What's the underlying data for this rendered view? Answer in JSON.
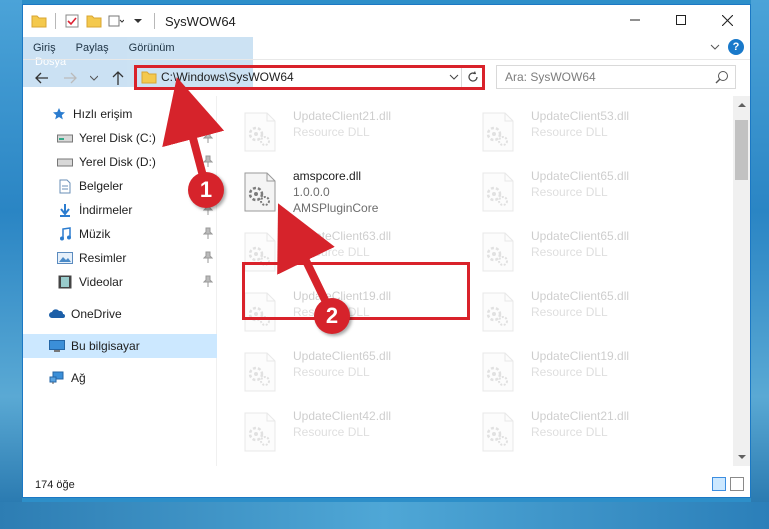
{
  "window": {
    "title": "SysWOW64",
    "controls": {
      "minimize": "—",
      "maximize": "☐",
      "close": "✕"
    }
  },
  "ribbon": {
    "tabs": [
      "Dosya",
      "Giriş",
      "Paylaş",
      "Görünüm"
    ],
    "help": "?"
  },
  "address": {
    "path": "C:\\Windows\\SysWOW64",
    "search_placeholder": "Ara: SysWOW64"
  },
  "sidebar": {
    "items": [
      {
        "label": "Hızlı erişim",
        "icon": "star-icon"
      },
      {
        "label": "Yerel Disk (C:)",
        "icon": "drive-icon",
        "pinned": true
      },
      {
        "label": "Yerel Disk (D:)",
        "icon": "drive-icon",
        "pinned": true
      },
      {
        "label": "Belgeler",
        "icon": "documents-icon",
        "pinned": true
      },
      {
        "label": "İndirmeler",
        "icon": "download-icon",
        "pinned": true
      },
      {
        "label": "Müzik",
        "icon": "music-icon",
        "pinned": true
      },
      {
        "label": "Resimler",
        "icon": "pictures-icon",
        "pinned": true
      },
      {
        "label": "Videolar",
        "icon": "videos-icon",
        "pinned": true
      },
      {
        "label": "OneDrive",
        "icon": "onedrive-icon"
      },
      {
        "label": "Bu bilgisayar",
        "icon": "computer-icon",
        "selected": true
      },
      {
        "label": "Ağ",
        "icon": "network-icon"
      }
    ]
  },
  "files": [
    {
      "name": "UpdateClient21.dll",
      "desc": "Resource DLL"
    },
    {
      "name": "UpdateClient53.dll",
      "desc": "Resource DLL"
    },
    {
      "name": "amspcore.dll",
      "version": "1.0.0.0",
      "desc": "AMSPluginCore"
    },
    {
      "name": "UpdateClient65.dll",
      "desc": "Resource DLL"
    },
    {
      "name": "UpdateClient63.dll",
      "desc": "Resource DLL"
    },
    {
      "name": "UpdateClient65.dll",
      "desc": "Resource DLL"
    },
    {
      "name": "UpdateClient19.dll",
      "desc": "Resource DLL"
    },
    {
      "name": "UpdateClient65.dll",
      "desc": "Resource DLL"
    },
    {
      "name": "UpdateClient65.dll",
      "desc": "Resource DLL"
    },
    {
      "name": "UpdateClient19.dll",
      "desc": "Resource DLL"
    },
    {
      "name": "UpdateClient42.dll",
      "desc": "Resource DLL"
    },
    {
      "name": "UpdateClient21.dll",
      "desc": "Resource DLL"
    }
  ],
  "status": {
    "count": "174 öğe"
  },
  "callouts": [
    "1",
    "2"
  ],
  "colors": {
    "accent": "#1979ca",
    "highlight": "#d9222a",
    "selection": "#cce8ff"
  }
}
